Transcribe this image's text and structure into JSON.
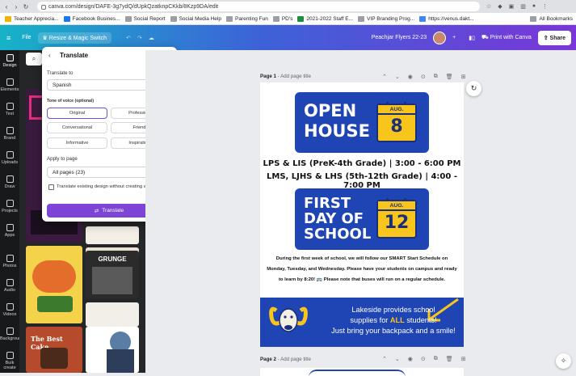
{
  "browser": {
    "url": "canva.com/design/DAFE-3g7ydQ/dUpkQzatknpCKkb/8Kzp9DA/edit",
    "bookmarks": [
      "Teacher Apprecia...",
      "Facebook Busines...",
      "Social Report",
      "Social Media Help",
      "Parenting Fun",
      "PD's",
      "2021-2022 Staff E...",
      "VIP Branding Prog...",
      "https://venus.dakt..."
    ],
    "all_bookmarks": "All Bookmarks"
  },
  "header": {
    "file": "File",
    "resize": "Resize & Magic Switch",
    "doc_title": "Peachjar Flyers 22-23",
    "print": "Print with Canva",
    "share": "Share"
  },
  "rail": [
    "Design",
    "Elements",
    "Text",
    "Brand",
    "Uploads",
    "Draw",
    "Projects",
    "Apps",
    "Photos",
    "Audio",
    "Videos",
    "Background",
    "Bulk create"
  ],
  "translate": {
    "title": "Translate",
    "translate_to_label": "Translate to",
    "language": "Spanish",
    "tone_label": "Tone of voice (optional)",
    "tones": [
      "Original",
      "Professional",
      "Conversational",
      "Friendly",
      "Informative",
      "Inspirational"
    ],
    "apply_label": "Apply to page",
    "apply_value": "All pages (23)",
    "checkbox_label": "Translate existing design without creating a copy",
    "button": "Translate"
  },
  "thumbs": {
    "grunge": "GRUNGE",
    "cake": "The Best Cake"
  },
  "page1": {
    "label": "Page 1",
    "add_title": " - Add page title",
    "banner1_l1": "OPEN",
    "banner1_l2": "HOUSE",
    "banner1_month": "AUG.",
    "banner1_day": "8",
    "line1": "LPS & LIS (PreK-4th Grade) | 3:00 - 6:00 PM",
    "line2": "LMS, LJHS & LHS (5th-12th Grade) | 4:00 - 7:00 PM",
    "banner2_l1": "FIRST",
    "banner2_l2": "DAY OF",
    "banner2_l3": "SCHOOL",
    "banner2_month": "AUG.",
    "banner2_day": "12",
    "paragraph": "During the first week of school, we will follow our SMART Start Schedule on Monday, Tuesday, and Wednesday. Please have your students on campus and ready to learn by 8:20! 🚌  Please note that buses will run on a regular schedule.",
    "footer_l1": "Lakeside provides school",
    "footer_l2a": "supplies for ",
    "footer_all": "ALL",
    "footer_l2b": " students!",
    "footer_l3": "Just bring your backpack and a smile!"
  },
  "page2": {
    "label": "Page 2",
    "add_title": " - Add page title"
  },
  "colors": {
    "accent": "#7c45d6",
    "flyer_blue": "#1f45b5",
    "flyer_yellow": "#f7c51b"
  }
}
